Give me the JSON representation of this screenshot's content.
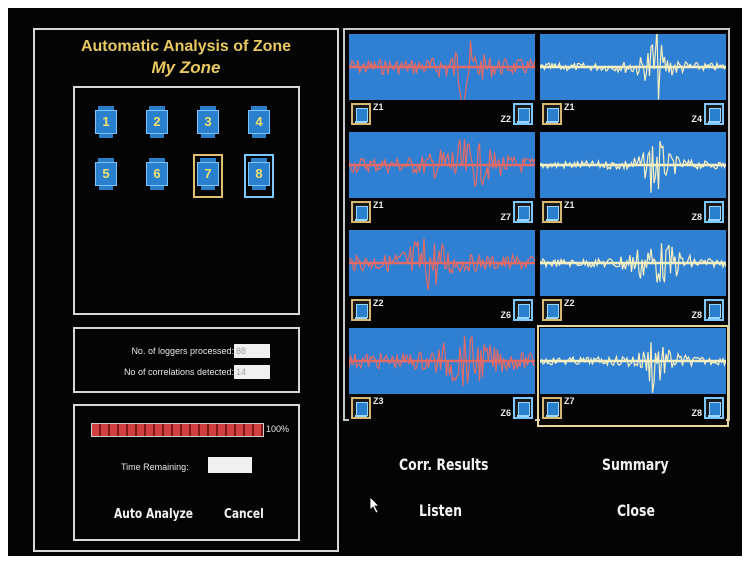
{
  "window": {
    "title": "Automatic Analysis of Zone",
    "zone_name": "My Zone"
  },
  "loggers": [
    {
      "label": "1",
      "state": "normal"
    },
    {
      "label": "2",
      "state": "normal"
    },
    {
      "label": "3",
      "state": "normal"
    },
    {
      "label": "4",
      "state": "normal"
    },
    {
      "label": "5",
      "state": "normal"
    },
    {
      "label": "6",
      "state": "normal"
    },
    {
      "label": "7",
      "state": "selected-yellow"
    },
    {
      "label": "8",
      "state": "selected-blue"
    }
  ],
  "stats": {
    "loggers_processed_label": "No. of loggers processed:",
    "loggers_processed_value": "88",
    "correlations_label": "No of correlations detected:",
    "correlations_value": "14"
  },
  "progress": {
    "percent_value": 100,
    "percent_label": "100%",
    "time_remaining_label": "Time Remaining:",
    "time_remaining_value": ""
  },
  "buttons": {
    "auto_analyze": "Auto Analyze",
    "cancel": "Cancel",
    "corr_results": "Corr. Results",
    "summary": "Summary",
    "listen": "Listen",
    "close": "Close"
  },
  "correlations": [
    {
      "left": "Z1",
      "right": "Z2",
      "color": "red",
      "profile": "spike"
    },
    {
      "left": "Z1",
      "right": "Z4",
      "color": "cream",
      "profile": "spike"
    },
    {
      "left": "Z1",
      "right": "Z7",
      "color": "red",
      "profile": "broad"
    },
    {
      "left": "Z1",
      "right": "Z8",
      "color": "cream",
      "profile": "spike"
    },
    {
      "left": "Z2",
      "right": "Z6",
      "color": "red",
      "profile": "burst"
    },
    {
      "left": "Z2",
      "right": "Z8",
      "color": "cream",
      "profile": "broad"
    },
    {
      "left": "Z3",
      "right": "Z6",
      "color": "red",
      "profile": "broad"
    },
    {
      "left": "Z7",
      "right": "Z8",
      "color": "cream",
      "profile": "spike",
      "selected": true
    }
  ],
  "colors": {
    "red": "#e26b68",
    "cream": "#f6f0c0",
    "wave_bg": "#2f7fd2",
    "title": "#e8c860"
  }
}
